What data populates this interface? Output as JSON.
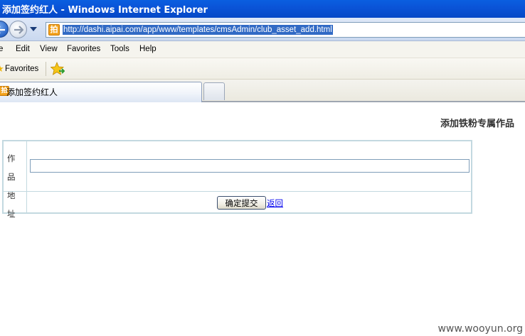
{
  "window": {
    "title": "添加签约红人 - Windows Internet Explorer"
  },
  "addressbar": {
    "url": "http://dashi.aipai.com/app/www/templates/cmsAdmin/club_asset_add.html",
    "site_icon_glyph": "拍"
  },
  "menubar": {
    "items": [
      "e",
      "Edit",
      "View",
      "Favorites",
      "Tools",
      "Help"
    ]
  },
  "favbar": {
    "favorites_label": "Favorites"
  },
  "tabs": {
    "active_label": "添加签约红人",
    "tab_icon_glyph": "拍"
  },
  "page": {
    "heading": "添加铁粉专属作品",
    "field_label_line1": "作品",
    "field_label_line2": "地址",
    "input_value": "",
    "submit_label": "确定提交",
    "back_label": "返回",
    "watermark": "www.wooyun.org"
  },
  "colors": {
    "titlebar": "#0a54d8",
    "url_highlight": "#316ac5",
    "table_border": "#c3d9e0",
    "link": "#0000ee"
  }
}
